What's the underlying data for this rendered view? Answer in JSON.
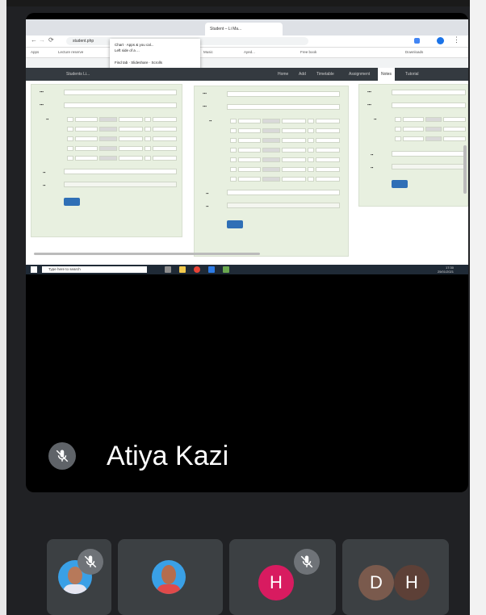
{
  "speaker": {
    "name": "Atiya Kazi"
  },
  "browser": {
    "tabs": [
      "",
      "",
      "",
      "Student – Li Ma..."
    ],
    "address": "student.php",
    "bookmarks": [
      "Apps",
      "Lecture reserve",
      "Music",
      "Ayed...",
      "Free book",
      "Downloads"
    ],
    "popup_lines": [
      "Chart · Apps & you cal...",
      "Left side of a ...",
      "Find tab · Slideshare · Scrolls"
    ]
  },
  "app_nav": {
    "brand": "Students Li...",
    "items": [
      "Home",
      "Add",
      "Timetable",
      "Assignment",
      "Notes",
      "Tutorial"
    ],
    "active_index": 4
  },
  "taskbar": {
    "search_placeholder": "Type here to search",
    "time": "17:30",
    "date": "25/01/2021"
  },
  "participants": [
    {
      "type": "photo",
      "muted": true
    },
    {
      "type": "photo",
      "muted": false
    },
    {
      "type": "letter",
      "letter": "H",
      "color": "#d81b60",
      "muted": true
    },
    {
      "type": "letters",
      "letters": [
        "D",
        "H"
      ],
      "colors": [
        "#7a5a4d",
        "#5d4037"
      ],
      "muted": false
    }
  ]
}
